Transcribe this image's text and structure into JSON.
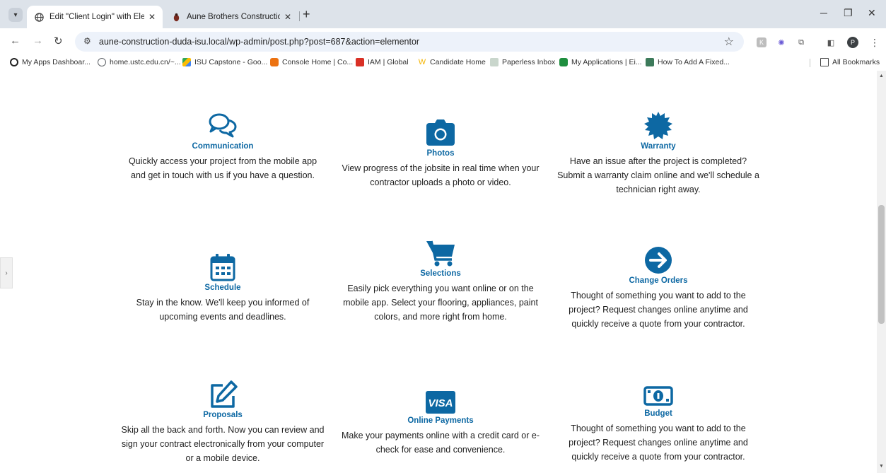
{
  "browser": {
    "tabs": [
      {
        "title": "Edit \"Client Login\" with Element",
        "active": true
      },
      {
        "title": "Aune Brothers Construction",
        "active": false
      }
    ],
    "url": "aune-construction-duda-isu.local/wp-admin/post.php?post=687&action=elementor",
    "bookmarks": [
      {
        "label": "My Apps Dashboar...",
        "color": "#222222"
      },
      {
        "label": "home.ustc.edu.cn/~...",
        "color": "#5f6368"
      },
      {
        "label": "ISU Capstone - Goo...",
        "color": "#fbbc04"
      },
      {
        "label": "Console Home | Co...",
        "color": "#ec7211"
      },
      {
        "label": "IAM | Global",
        "color": "#d93025"
      },
      {
        "label": "Candidate Home",
        "color": "#f4b400"
      },
      {
        "label": "Paperless Inbox",
        "color": "#17541f"
      },
      {
        "label": "My Applications | Ei...",
        "color": "#1e8e3e"
      },
      {
        "label": "How To Add A Fixed...",
        "color": "#3c7a5a"
      }
    ],
    "all_bookmarks": "All Bookmarks",
    "profile_initial": "P"
  },
  "accent_color": "#0d68a3",
  "features": [
    {
      "icon": "chat-bubbles-icon",
      "title": "Communication",
      "description": "Quickly access your project from the mobile app and get in touch with us if you have a question."
    },
    {
      "icon": "camera-icon",
      "title": "Photos",
      "description": "View progress of the jobsite in real time when your contractor uploads a photo or video."
    },
    {
      "icon": "certificate-icon",
      "title": "Warranty",
      "description": "Have an issue after the project is completed? Submit a warranty claim online and we'll schedule a technician right away."
    },
    {
      "icon": "calendar-icon",
      "title": "Schedule",
      "description": "Stay in the know. We'll keep you informed of upcoming events and deadlines."
    },
    {
      "icon": "shopping-cart-icon",
      "title": "Selections",
      "description": "Easily pick everything you want online or on the mobile app. Select your flooring, appliances, paint colors, and more right from home."
    },
    {
      "icon": "arrow-circle-right-icon",
      "title": "Change Orders",
      "description": "Thought of something you want to add to the project? Request changes online anytime and quickly receive a quote from your contractor."
    },
    {
      "icon": "edit-icon",
      "title": "Proposals",
      "description": "Skip all the back and forth. Now you can review and sign your contract electronically from your computer or a mobile device."
    },
    {
      "icon": "visa-card-icon",
      "title": "Online Payments",
      "description": "Make your payments online with a credit card or e-check for ease and convenience."
    },
    {
      "icon": "money-bill-icon",
      "title": "Budget",
      "description": "Thought of something you want to add to the project? Request changes online anytime and quickly receive a quote from your contractor."
    }
  ],
  "visa_text": "VISA"
}
